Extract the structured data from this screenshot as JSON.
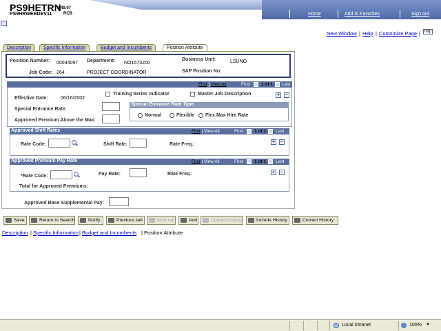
{
  "header": {
    "app_title": "PS9HETRN",
    "version": "8.49.07",
    "db": "PS9HRWEBDEV11",
    "user": "RCB",
    "links": {
      "home": "Home",
      "favorites": "Add to Favorites",
      "signout": "Sign out"
    }
  },
  "top_links": {
    "new_window": "New Window",
    "help": "Help",
    "customize": "Customize Page",
    "http": "http"
  },
  "tabs": [
    {
      "label": "Description",
      "active": false
    },
    {
      "label": "Specific Information",
      "active": false
    },
    {
      "label": "Budget and Incumbents",
      "active": false
    },
    {
      "label": "Position Attribute",
      "active": true
    }
  ],
  "position": {
    "number_label": "Position Number:",
    "number": "00034097",
    "dept_label": "Department:",
    "dept": "NO1573200",
    "bu_label": "Business Unit:",
    "bu": "LSUNO",
    "jobcode_label": "Job Code:",
    "jobcode": "264",
    "jobtitle": "PROJECT COORDINATOR",
    "sap_label": "SAP Position No:"
  },
  "date_section": {
    "nav": {
      "find": "Find",
      "view_all": "View All",
      "first": "First",
      "count": "1 of 1",
      "last": "Last"
    },
    "effective_date_label": "Effective Date:",
    "effective_date": "06/16/2002",
    "training_label": "Training Series Indicator",
    "master_label": "Master Job Description",
    "special_rate_label": "Special Entrance Rate:",
    "premium_label": "Approved Premium Above the Max:",
    "rate_type_title": "Special Entrance Rate Type",
    "radio_normal": "Normal",
    "radio_flexible": "Flexible",
    "radio_flexmax": "Flex.Max Hire Rate"
  },
  "shift_rates": {
    "title": "Approved Shift Rates",
    "nav": {
      "find": "Find",
      "view_all": "View All",
      "first": "First",
      "count": "1 of 1",
      "last": "Last"
    },
    "rate_code_label": "Rate Code:",
    "shift_rate_label": "Shift Rate:",
    "rate_freq_label": "Rate Freq.:"
  },
  "premium_pay": {
    "title": "Approved Premium Pay Rate",
    "nav": {
      "find": "Find",
      "view_all": "View All",
      "first": "First",
      "count": "1 of 1",
      "last": "Last"
    },
    "rate_code_label": "*Rate Code:",
    "pay_rate_label": "Pay Rate:",
    "rate_freq_label": "Rate Freq.:",
    "total_label": "Total for Approved Premiums:"
  },
  "base_supp_label": "Approved Base Supplemental Pay:",
  "toolbar": {
    "save": "Save",
    "return": "Return to Search",
    "notify": "Notify",
    "previous": "Previous tab",
    "next": "Next tab",
    "add": "Add",
    "update": "Update/Display",
    "include": "Include History",
    "correct": "Correct History"
  },
  "bottom_links": [
    "Description",
    "Specific Information",
    "Budget and Incumbents",
    "Position Attribute"
  ],
  "status_bar": {
    "zone": "Local intranet",
    "zoom": "100%"
  }
}
